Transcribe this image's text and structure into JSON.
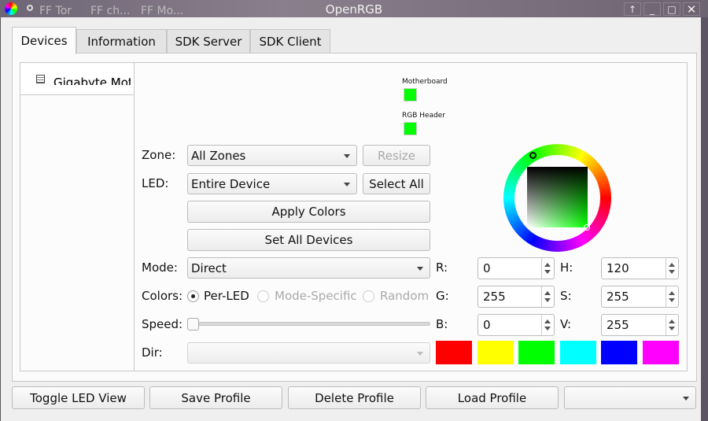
{
  "titlebar": {
    "title": "OpenRGB",
    "taskbar_items": [
      "FF Tor",
      "FF ch...",
      "FF Mo..."
    ]
  },
  "tabs": [
    {
      "label": "Devices",
      "selected": true
    },
    {
      "label": "Information"
    },
    {
      "label": "SDK Server"
    },
    {
      "label": "SDK Client"
    }
  ],
  "devices": [
    {
      "label": "Gigabyte Motherboard",
      "visible_text": "Gigabyte Mot",
      "icon": "motherboard-icon"
    }
  ],
  "zones": [
    {
      "label": "Motherboard",
      "color": "#00ff00"
    },
    {
      "label": "RGB Header",
      "color": "#00ff00"
    }
  ],
  "controls": {
    "zone_label": "Zone:",
    "zone_value": "All Zones",
    "resize_label": "Resize",
    "led_label": "LED:",
    "led_value": "Entire Device",
    "select_all_label": "Select All",
    "apply_colors_label": "Apply Colors",
    "set_all_devices_label": "Set All Devices",
    "mode_label": "Mode:",
    "mode_value": "Direct",
    "colors_label": "Colors:",
    "radio_per_led": "Per-LED",
    "radio_mode_specific": "Mode-Specific",
    "radio_random": "Random",
    "speed_label": "Speed:",
    "speed_value": 0,
    "dir_label": "Dir:",
    "dir_value": ""
  },
  "color": {
    "r_label": "R:",
    "r": "0",
    "g_label": "G:",
    "g": "255",
    "b_label": "B:",
    "b": "0",
    "h_label": "H:",
    "h": "120",
    "s_label": "S:",
    "s": "255",
    "v_label": "V:",
    "v": "255",
    "swatches": [
      "#ff0000",
      "#ffff00",
      "#00ff00",
      "#00ffff",
      "#0000ff",
      "#ff00ff"
    ]
  },
  "bottom": {
    "toggle_led_view": "Toggle LED View",
    "save_profile": "Save Profile",
    "delete_profile": "Delete Profile",
    "load_profile": "Load Profile",
    "profile_value": ""
  }
}
